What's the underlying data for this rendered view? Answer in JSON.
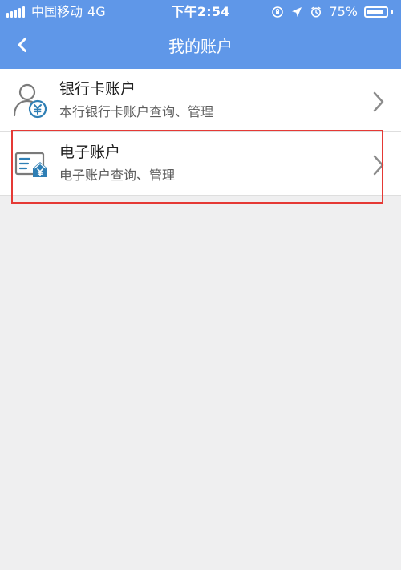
{
  "status_bar": {
    "carrier": "中国移动",
    "network": "4G",
    "time": "下午2:54",
    "battery": "75%"
  },
  "nav": {
    "title": "我的账户"
  },
  "items": [
    {
      "title": "银行卡账户",
      "subtitle": "本行银行卡账户查询、管理",
      "icon": "user-yuan-icon"
    },
    {
      "title": "电子账户",
      "subtitle": "电子账户查询、管理",
      "icon": "ecard-home-icon"
    }
  ],
  "colors": {
    "header_bg": "#5f97e8",
    "page_bg": "#efeff0",
    "highlight": "#e53935",
    "icon_blue": "#2f7fb5",
    "icon_gray": "#7a7a7a"
  }
}
